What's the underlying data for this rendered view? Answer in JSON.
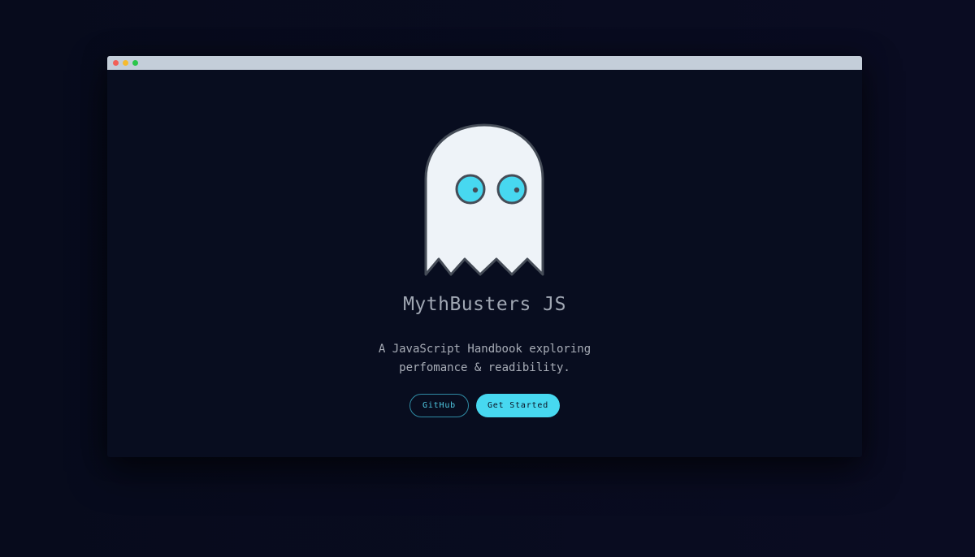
{
  "window": {
    "controls": [
      "close",
      "minimize",
      "maximize"
    ]
  },
  "hero": {
    "logo_icon": "ghost-icon",
    "title": "MythBusters JS",
    "tagline_line1": "A JavaScript Handbook exploring",
    "tagline_line2": "perfomance & readibility."
  },
  "actions": {
    "github_label": "GitHub",
    "get_started_label": "Get Started"
  },
  "colors": {
    "background": "#080d1f",
    "accent": "#47d8f0",
    "ghost_body": "#eef3f8",
    "ghost_outline": "#454c57",
    "titlebar": "#c4ced9"
  }
}
